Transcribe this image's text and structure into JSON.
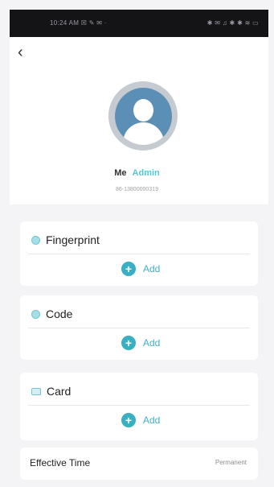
{
  "status_bar": {
    "left_text": "10:24 AM ☒ ✎ ✉ ·",
    "right_text": "✱ ✉ ♫ ✱ ✱ ≋ ▭"
  },
  "header": {
    "back_icon": "chevron-left-icon",
    "back_label": "‹"
  },
  "profile": {
    "avatar_icon": "user-avatar-icon",
    "name": "Me",
    "role": "Admin",
    "phone": "86-13800000319"
  },
  "sections": {
    "fingerprint": {
      "title": "Fingerprint",
      "icon": "fingerprint-icon",
      "add_label": "Add",
      "add_icon": "plus-icon"
    },
    "code": {
      "title": "Code",
      "icon": "code-icon",
      "add_label": "Add",
      "add_icon": "plus-icon"
    },
    "card": {
      "title": "Card",
      "icon": "card-icon",
      "add_label": "Add",
      "add_icon": "plus-icon"
    },
    "effective_time": {
      "label": "Effective Time",
      "value": "Permanent"
    }
  },
  "colors": {
    "accent": "#3aaec3",
    "role": "#59c6d6",
    "avatar_bg": "#5c8fb6",
    "background": "#f4f4f6"
  }
}
